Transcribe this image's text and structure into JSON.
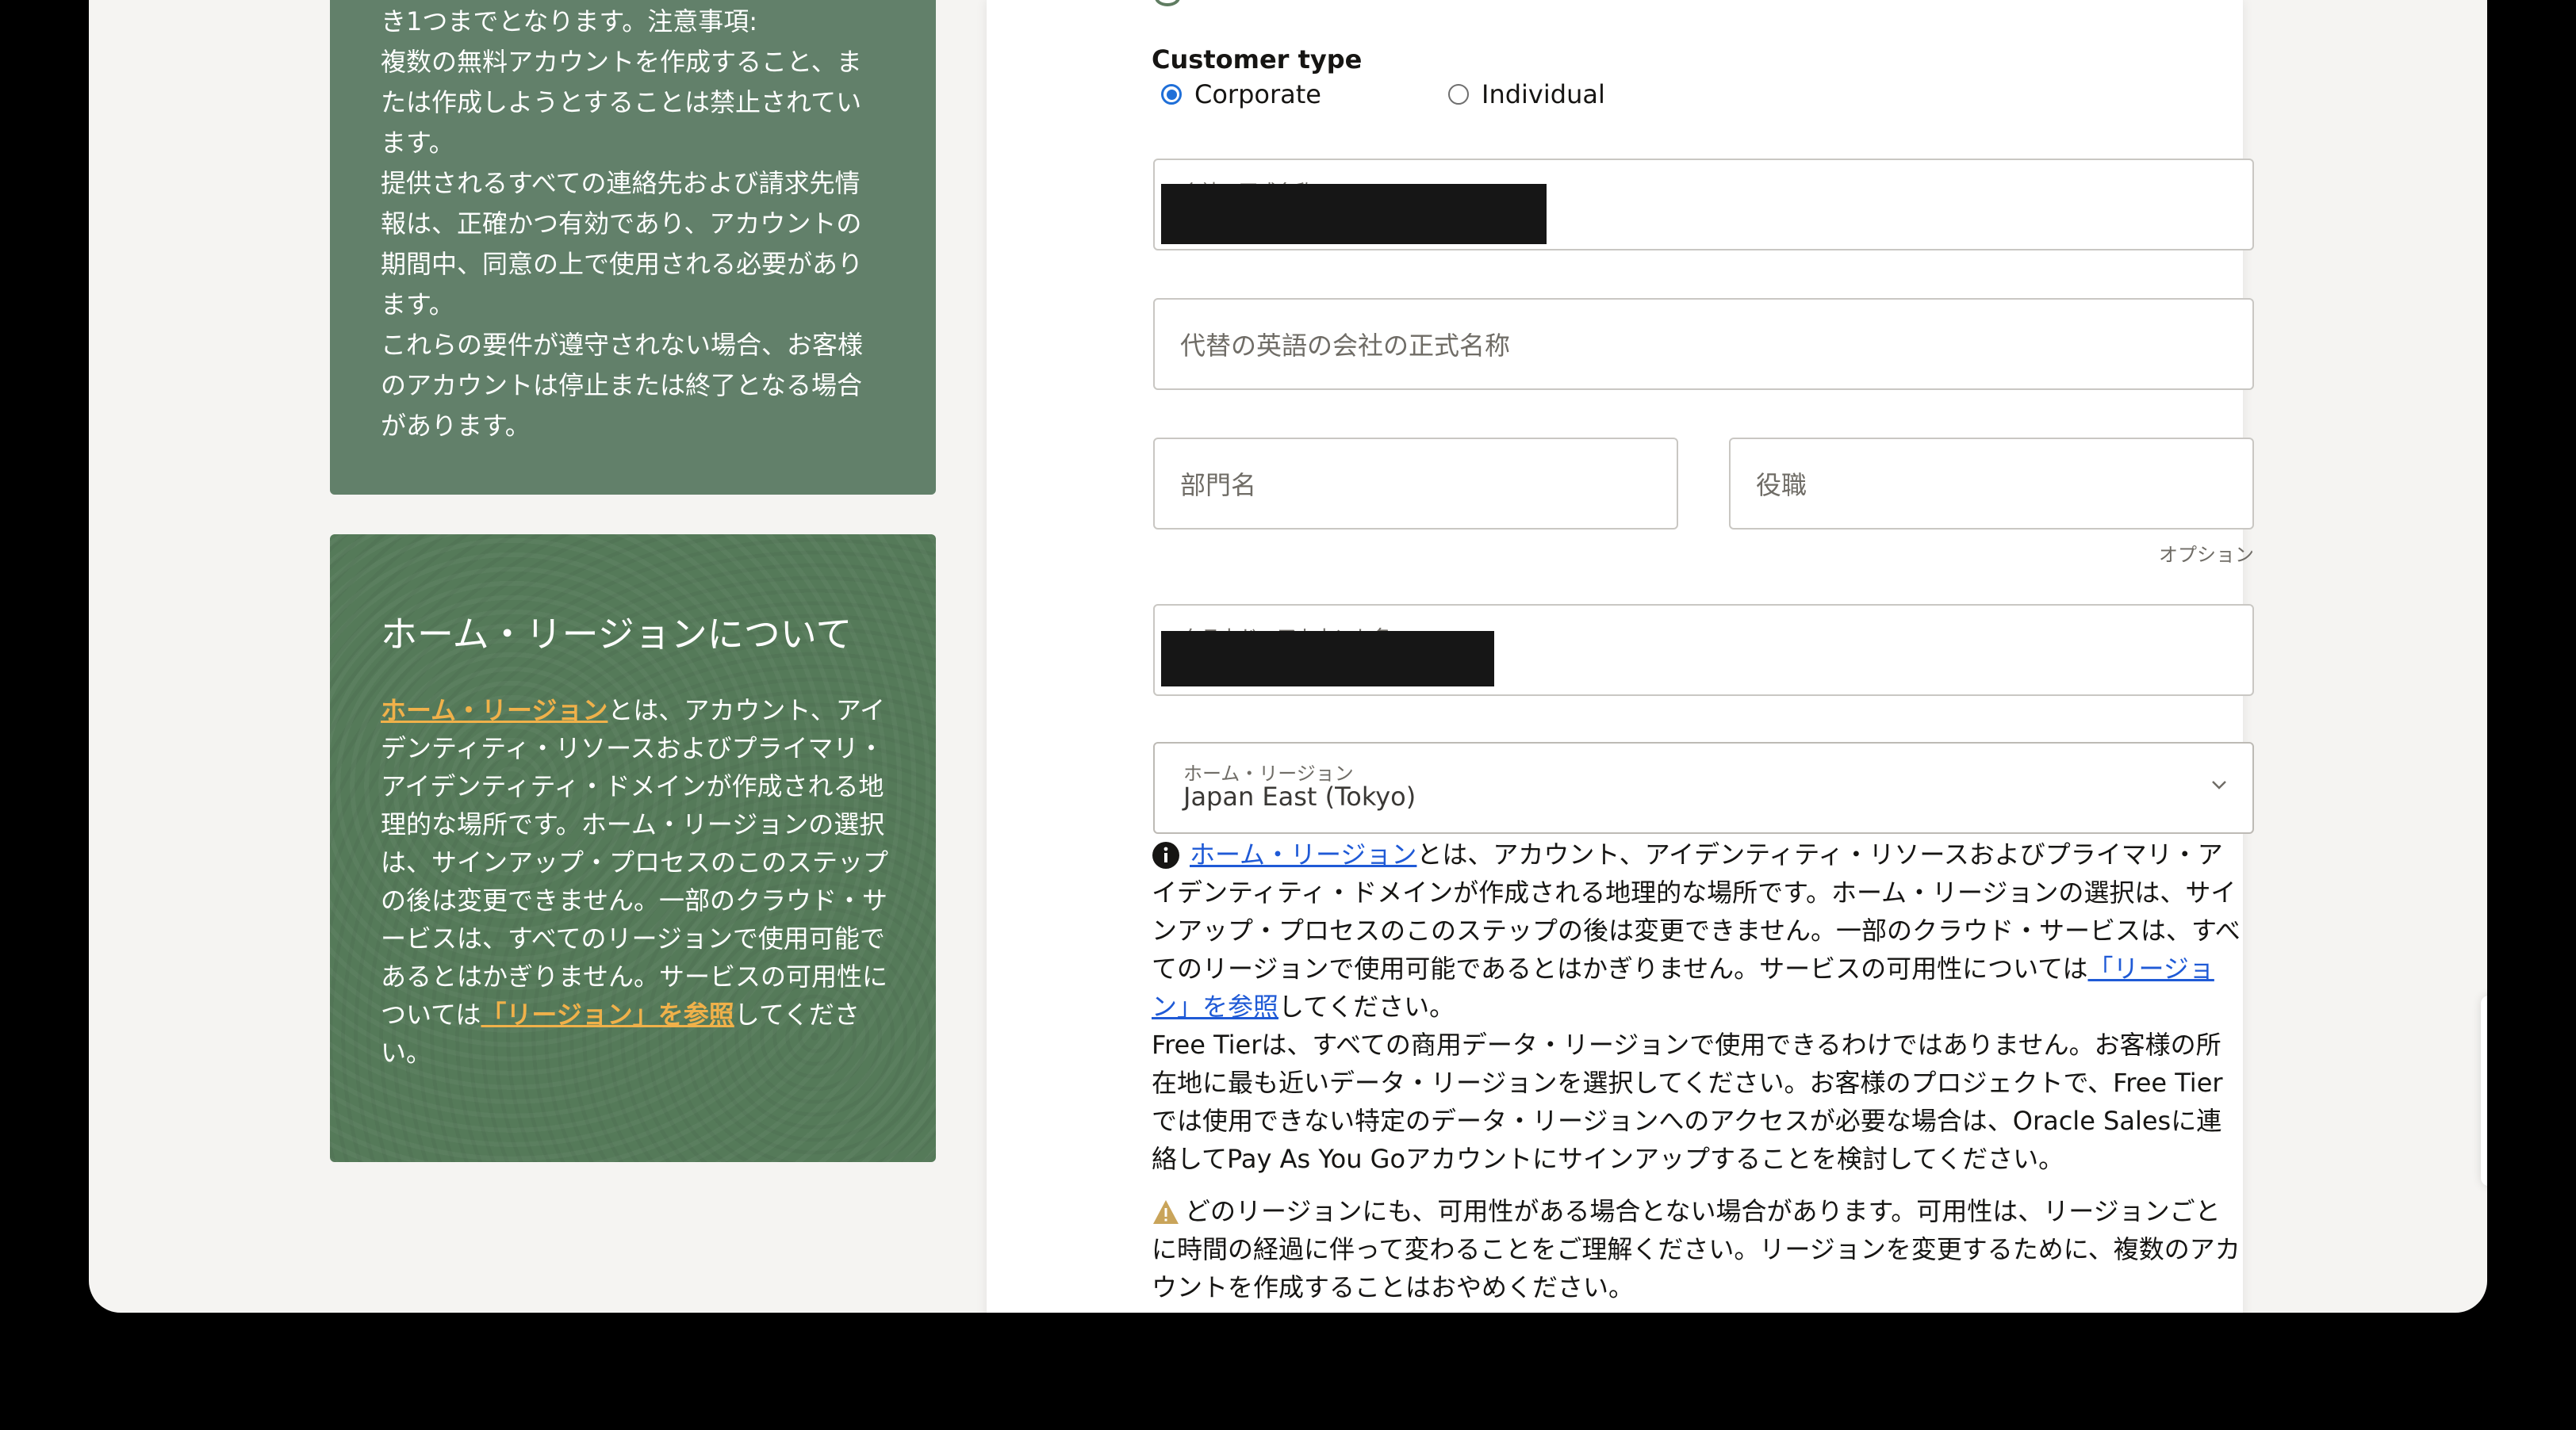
{
  "left_panel_top": {
    "lines": [
      "き1つまでとなります。注意事項:",
      "複数の無料アカウントを作成すること、ま",
      "たは作成しようとすることは禁止されてい",
      "ます。",
      "提供されるすべての連絡先および請求先情",
      "報は、正確かつ有効であり、アカウントの",
      "期間中、同意の上で使用される必要があり",
      "ます。",
      "これらの要件が遵守されない場合、お客様",
      "のアカウントは停止または終了となる場合",
      "があります。"
    ]
  },
  "left_panel_home_region": {
    "title": "ホーム・リージョンについて",
    "link_home_region": "ホーム・リージョン",
    "text_1": "とは、アカウント、アイデンティティ・リソースおよびプライマリ・アイデンティティ・ドメインが作成される地理的な場所です。ホーム・リージョンの選択は、サインアップ・プロセスのこのステップの後は変更できません。一部のクラウド・サービスは、すべてのリージョンで使用可能であるとはかぎりません。サービスの可用性については",
    "link_regions": "「リージョン」を参照",
    "text_2": "してください。"
  },
  "form": {
    "customer_type_label": "Customer type",
    "radio_corporate": "Corporate",
    "radio_individual": "Individual",
    "company_name_label": "会社の正式名称",
    "alt_company_name_placeholder": "代替の英語の会社の正式名称",
    "department_placeholder": "部門名",
    "job_title_placeholder": "役職",
    "optional_hint": "オプション",
    "cloud_account_label": "クラウド・アカウント名",
    "home_region_label": "ホーム・リージョン",
    "home_region_value": "Japan East (Tokyo)"
  },
  "info": {
    "link_home_region": "ホーム・リージョン",
    "text_1": "とは、アカウント、アイデンティティ・リソースおよびプライマリ・アイデンティティ・ドメインが作成される地理的な場所です。ホーム・リージョンの選択は、サインアップ・プロセスのこのステップの後は変更できません。一部のクラウド・サービスは、すべてのリージョンで使用可能であるとはかぎりません。サービスの可用性については",
    "link_regions": "「リージョン」を参照",
    "text_2": "してください。",
    "free_tier_text": "Free Tierは、すべての商用データ・リージョンで使用できるわけではありません。お客様の所在地に最も近いデータ・リージョンを選択してください。お客様のプロジェクトで、Free Tierでは使用できない特定のデータ・リージョンへのアクセスが必要な場合は、Oracle Salesに連絡してPay As You Goアカウントにサインアップすることを検討してください。",
    "warning_text": "どのリージョンにも、可用性がある場合とない場合があります。可用性は、リージョンごとに時間の経過に伴って変わることをご理解ください。リージョンを変更するために、複数のアカウントを作成することはおやめください。"
  },
  "colors": {
    "panel_green": "#5f7c61",
    "link_orange": "#f0b14a",
    "link_blue": "#1f5ad6",
    "radio_blue": "#1f6fd8",
    "contact_red": "#c74634"
  },
  "icons": {
    "info": "info-icon",
    "warning": "warning-icon",
    "chat": "chat-icon",
    "phone": "phone-icon",
    "chevron": "chevron-down-icon"
  }
}
